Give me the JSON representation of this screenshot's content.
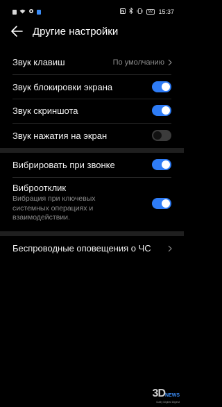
{
  "status_bar": {
    "left_icons": [
      "notification-icon",
      "wifi-icon",
      "settings-gear-icon",
      "app-icon"
    ],
    "right_icons": [
      "nfc-icon",
      "bluetooth-icon",
      "vibrate-icon"
    ],
    "battery": "92",
    "time": "15:37"
  },
  "header": {
    "title": "Другие настройки"
  },
  "settings": {
    "key_sound": {
      "label": "Звук клавиш",
      "value": "По умолчанию"
    },
    "lock_sound": {
      "label": "Звук блокировки экрана",
      "enabled": true
    },
    "screenshot_sound": {
      "label": "Звук скриншота",
      "enabled": true
    },
    "touch_sound": {
      "label": "Звук нажатия на экран",
      "enabled": false
    },
    "vibrate_on_ring": {
      "label": "Вибрировать при звонке",
      "enabled": true
    },
    "haptic": {
      "label": "Виброотклик",
      "description": "Вибрация при ключевых системных операциях и взаимодействии.",
      "enabled": true
    },
    "emergency_alerts": {
      "label": "Беспроводные оповещения о ЧС"
    }
  },
  "watermark": {
    "main": "3D",
    "news": "NEWS",
    "sub": "Daily Digital Digest"
  },
  "colors": {
    "accent": "#2e7cf6",
    "background": "#000000",
    "secondary_text": "#8c8c8c"
  }
}
